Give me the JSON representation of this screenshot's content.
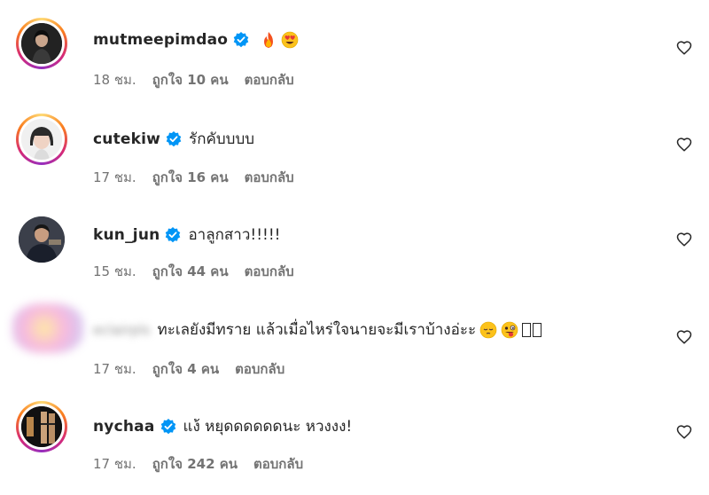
{
  "comments": [
    {
      "username": "mutmeepimdao",
      "verified": true,
      "text": "",
      "emojis": [
        "fire-emoji",
        "heart-eyes-emoji"
      ],
      "time": "18 ชม.",
      "likes": "ถูกใจ 10 คน",
      "reply": "ตอบกลับ"
    },
    {
      "username": "cutekiw",
      "verified": true,
      "text": "รักคับบบบ",
      "emojis": [],
      "time": "17 ชม.",
      "likes": "ถูกใจ 16 คน",
      "reply": "ตอบกลับ"
    },
    {
      "username": "kun_jun",
      "verified": true,
      "text": "อาลูกสาว!!!!!",
      "emojis": [],
      "time": "15 ชม.",
      "likes": "ถูกใจ 44 คน",
      "reply": "ตอบกลับ"
    },
    {
      "username": "eclairpls",
      "verified": false,
      "text": "ทะเลยังมีทราย แล้วเมื่อไหร่ใจนายจะมีเราบ้างอ่ะะ",
      "emojis": [
        "pensive-emoji",
        "tongue-wink-emoji"
      ],
      "trailing": "",
      "time": "17 ชม.",
      "likes": "ถูกใจ 4 คน",
      "reply": "ตอบกลับ"
    },
    {
      "username": "nychaa",
      "verified": true,
      "text": "แง้ หยุดดดดดดนะ หวงงง!",
      "emojis": [],
      "time": "17 ชม.",
      "likes": "ถูกใจ 242 คน",
      "reply": "ตอบกลับ"
    }
  ]
}
